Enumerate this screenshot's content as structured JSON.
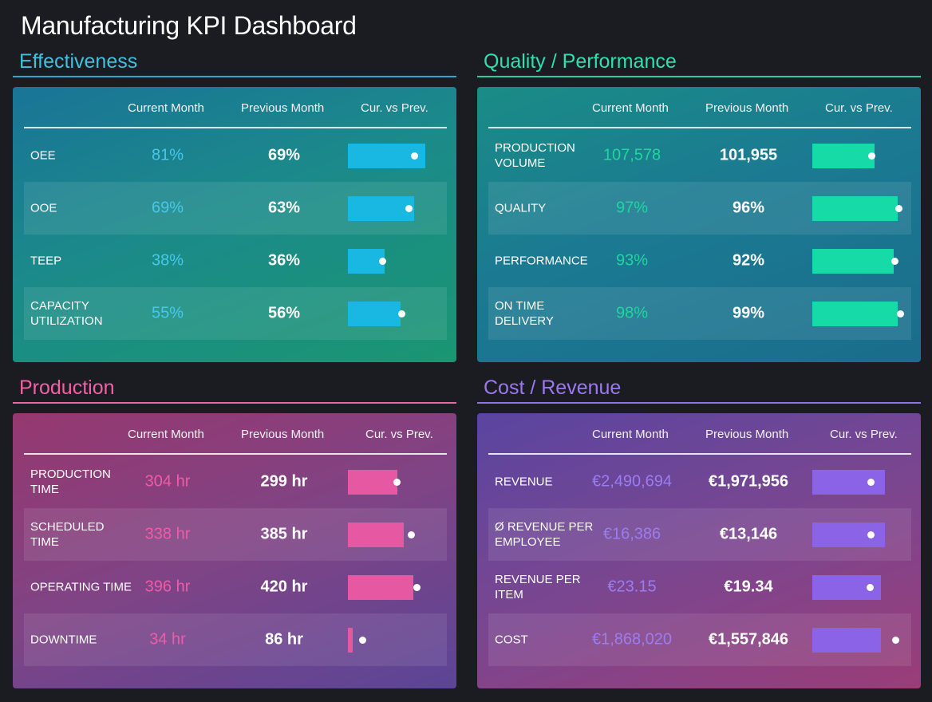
{
  "title": "Manufacturing KPI Dashboard",
  "colors": {
    "effectiveness": "#29b5d8",
    "quality": "#1fd6a6",
    "production": "#e9589d",
    "cost": "#8a63e6"
  },
  "sections": [
    {
      "id": "effectiveness",
      "title": "Effectiveness",
      "headers": {
        "current": "Current Month",
        "previous": "Previous Month",
        "compare": "Cur. vs Prev."
      },
      "rows": [
        {
          "label": "OEE",
          "current": "81%",
          "previous": "69%",
          "cur_fraction": 0.81,
          "prev_fraction": 0.69
        },
        {
          "label": "OOE",
          "current": "69%",
          "previous": "63%",
          "cur_fraction": 0.69,
          "prev_fraction": 0.63
        },
        {
          "label": "TEEP",
          "current": "38%",
          "previous": "36%",
          "cur_fraction": 0.38,
          "prev_fraction": 0.36
        },
        {
          "label": "CAPACITY UTILIZATION",
          "current": "55%",
          "previous": "56%",
          "cur_fraction": 0.55,
          "prev_fraction": 0.56
        }
      ]
    },
    {
      "id": "quality",
      "title": "Quality / Performance",
      "headers": {
        "current": "Current Month",
        "previous": "Previous Month",
        "compare": "Cur. vs Prev."
      },
      "rows": [
        {
          "label": "PRODUCTION VOLUME",
          "current": "107,578",
          "previous": "101,955",
          "cur_fraction": 0.65,
          "prev_fraction": 0.62
        },
        {
          "label": "QUALITY",
          "current": "97%",
          "previous": "96%",
          "cur_fraction": 0.89,
          "prev_fraction": 0.9
        },
        {
          "label": "PERFORMANCE",
          "current": "93%",
          "previous": "92%",
          "cur_fraction": 0.85,
          "prev_fraction": 0.86
        },
        {
          "label": "ON TIME DELIVERY",
          "current": "98%",
          "previous": "99%",
          "cur_fraction": 0.89,
          "prev_fraction": 0.92
        }
      ]
    },
    {
      "id": "production",
      "title": "Production",
      "headers": {
        "current": "Current Month",
        "previous": "Previous Month",
        "compare": "Cur. vs Prev."
      },
      "rows": [
        {
          "label": "PRODUCTION TIME",
          "current": "304 hr",
          "previous": "299 hr",
          "cur_fraction": 0.52,
          "prev_fraction": 0.51
        },
        {
          "label": "SCHEDULED TIME",
          "current": "338 hr",
          "previous": "385 hr",
          "cur_fraction": 0.58,
          "prev_fraction": 0.66
        },
        {
          "label": "OPERATING TIME",
          "current": "396 hr",
          "previous": "420 hr",
          "cur_fraction": 0.68,
          "prev_fraction": 0.72
        },
        {
          "label": "DOWNTIME",
          "current": "34 hr",
          "previous": "86 hr",
          "cur_fraction": 0.05,
          "prev_fraction": 0.15
        }
      ]
    },
    {
      "id": "cost",
      "title": "Cost / Revenue",
      "headers": {
        "current": "Current Month",
        "previous": "Previous Month",
        "compare": "Cur. vs Prev."
      },
      "rows": [
        {
          "label": "REVENUE",
          "current": "€2,490,694",
          "previous": "€1,971,956",
          "cur_fraction": 0.76,
          "prev_fraction": 0.61
        },
        {
          "label": "Ø REVENUE PER EMPLOYEE",
          "current": "€16,386",
          "previous": "€13,146",
          "cur_fraction": 0.76,
          "prev_fraction": 0.61
        },
        {
          "label": "REVENUE PER ITEM",
          "current": "€23.15",
          "previous": "€19.34",
          "cur_fraction": 0.72,
          "prev_fraction": 0.6
        },
        {
          "label": "COST",
          "current": "€1,868,020",
          "previous": "€1,557,846",
          "cur_fraction": 0.72,
          "prev_fraction": 0.87
        }
      ]
    }
  ]
}
